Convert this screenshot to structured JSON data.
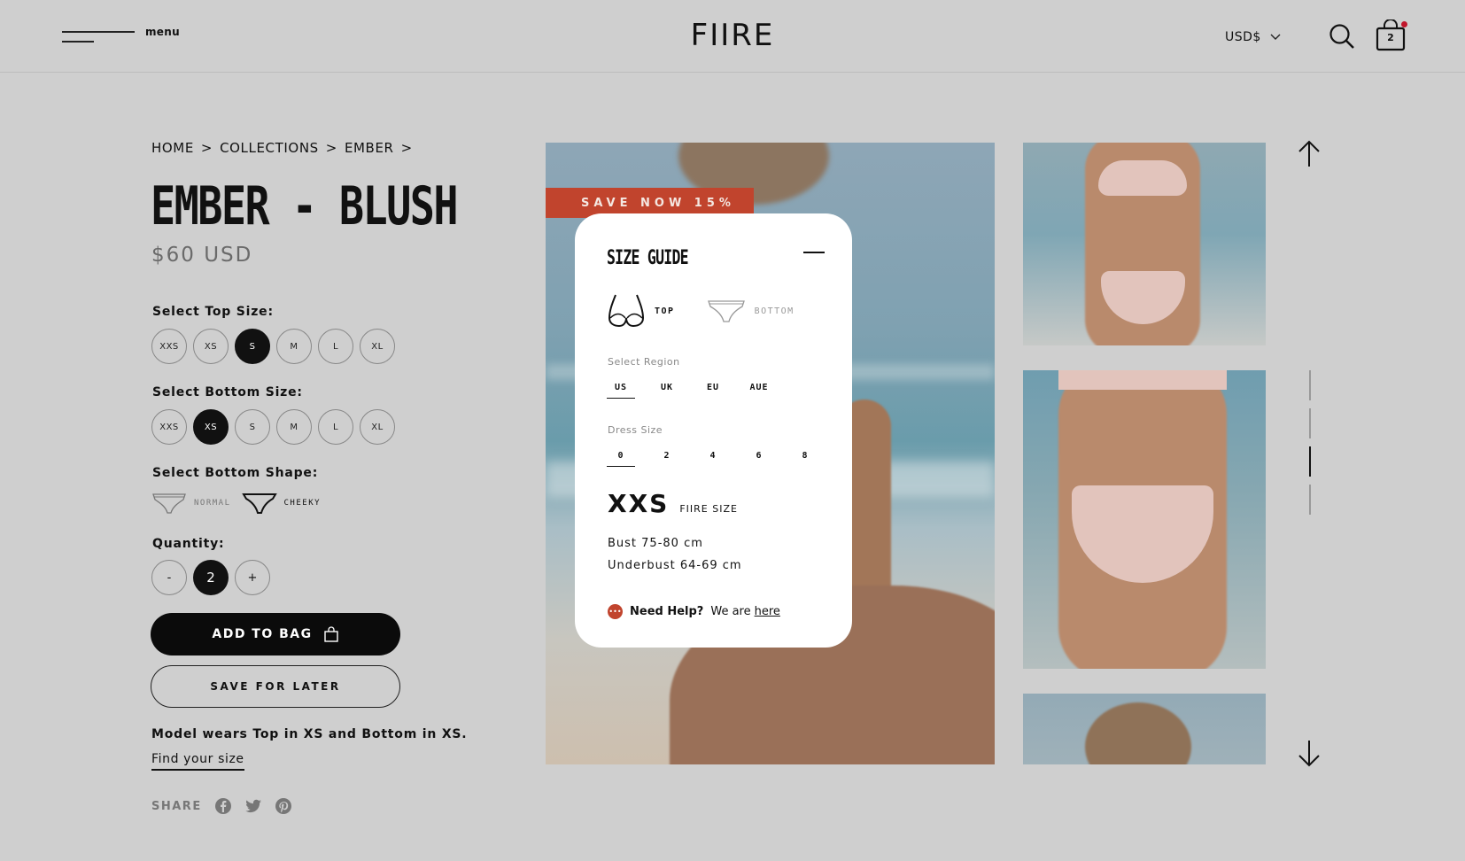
{
  "header": {
    "menu_label": "menu",
    "logo": "FIIRE",
    "currency": "USD$",
    "bag_count": "2"
  },
  "breadcrumb": [
    "HOME",
    "COLLECTIONS",
    "EMBER"
  ],
  "product": {
    "title": "EMBER - BLUSH",
    "price": "$60 USD"
  },
  "top_size": {
    "label": "Select Top Size:",
    "options": [
      "XXS",
      "XS",
      "S",
      "M",
      "L",
      "XL"
    ],
    "selected": "S"
  },
  "bottom_size": {
    "label": "Select Bottom Size:",
    "options": [
      "XXS",
      "XS",
      "S",
      "M",
      "L",
      "XL"
    ],
    "selected": "XS"
  },
  "bottom_shape": {
    "label": "Select Bottom Shape:",
    "options": [
      "NORMAL",
      "CHEEKY"
    ],
    "selected": "CHEEKY"
  },
  "quantity": {
    "label": "Quantity:",
    "minus": "-",
    "value": "2",
    "plus": "+"
  },
  "actions": {
    "add_to_bag": "ADD TO BAG",
    "save_for_later": "SAVE FOR LATER"
  },
  "model_note": "Model wears Top in XS and Bottom in XS.",
  "find_size": "Find your size",
  "share_label": "SHARE",
  "promo_banner": "SAVE NOW 15%",
  "size_guide": {
    "title": "SIZE GUIDE",
    "types": [
      "TOP",
      "BOTTOM"
    ],
    "selected_type": "TOP",
    "region_label": "Select Region",
    "regions": [
      "US",
      "UK",
      "EU",
      "AUE"
    ],
    "selected_region": "US",
    "dress_label": "Dress Size",
    "dress_sizes": [
      "0",
      "2",
      "4",
      "6",
      "8"
    ],
    "selected_dress": "0",
    "result_size": "XXS",
    "result_suffix": "FIIRE SIZE",
    "bust": "Bust 75-80 cm",
    "underbust": "Underbust 64-69 cm",
    "help_bold": "Need Help?",
    "help_text": "We are",
    "help_link": "here"
  },
  "gallery": {
    "progress_steps": 4,
    "active_step": 3
  }
}
